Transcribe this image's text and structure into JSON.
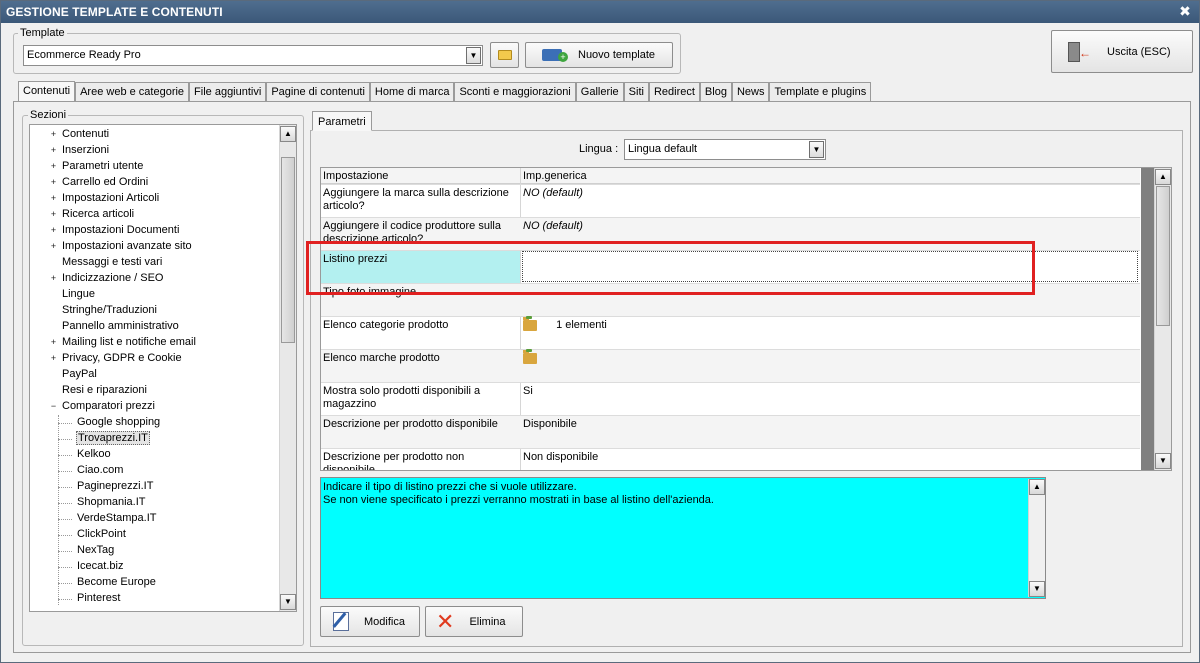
{
  "window": {
    "title": "GESTIONE TEMPLATE E CONTENUTI",
    "close_glyph": "✖"
  },
  "template": {
    "group_label": "Template",
    "selected": "Ecommerce Ready Pro",
    "new_button": "Nuovo template",
    "exit_button": "Uscita (ESC)"
  },
  "tabs": [
    {
      "label": "Contenuti",
      "active": true
    },
    {
      "label": "Aree web e categorie"
    },
    {
      "label": "File aggiuntivi"
    },
    {
      "label": "Pagine di contenuti"
    },
    {
      "label": "Home di marca"
    },
    {
      "label": "Sconti e maggiorazioni"
    },
    {
      "label": "Gallerie"
    },
    {
      "label": "Siti"
    },
    {
      "label": "Redirect"
    },
    {
      "label": "Blog"
    },
    {
      "label": "News"
    },
    {
      "label": "Template e plugins"
    }
  ],
  "sezioni": {
    "label": "Sezioni",
    "items": [
      {
        "label": "Contenuti",
        "expandable": true,
        "level": 1
      },
      {
        "label": "Inserzioni",
        "expandable": true,
        "level": 1
      },
      {
        "label": "Parametri utente",
        "expandable": true,
        "level": 1
      },
      {
        "label": "Carrello ed Ordini",
        "expandable": true,
        "level": 1
      },
      {
        "label": "Impostazioni Articoli",
        "expandable": true,
        "level": 1
      },
      {
        "label": "Ricerca articoli",
        "expandable": true,
        "level": 1
      },
      {
        "label": "Impostazioni Documenti",
        "expandable": true,
        "level": 1
      },
      {
        "label": "Impostazioni avanzate sito",
        "expandable": true,
        "level": 1
      },
      {
        "label": "Messaggi e testi vari",
        "expandable": false,
        "level": 1
      },
      {
        "label": "Indicizzazione / SEO",
        "expandable": true,
        "level": 1
      },
      {
        "label": "Lingue",
        "expandable": false,
        "level": 1
      },
      {
        "label": "Stringhe/Traduzioni",
        "expandable": false,
        "level": 1
      },
      {
        "label": "Pannello amministrativo",
        "expandable": false,
        "level": 1
      },
      {
        "label": "Mailing list e notifiche email",
        "expandable": true,
        "level": 1
      },
      {
        "label": "Privacy, GDPR e Cookie",
        "expandable": true,
        "level": 1
      },
      {
        "label": "PayPal",
        "expandable": false,
        "level": 1
      },
      {
        "label": "Resi e riparazioni",
        "expandable": false,
        "level": 1
      },
      {
        "label": "Comparatori prezzi",
        "expandable": true,
        "expanded": true,
        "level": 1
      },
      {
        "label": "Google shopping",
        "level": 2
      },
      {
        "label": "Trovaprezzi.IT",
        "level": 2,
        "selected": true
      },
      {
        "label": "Kelkoo",
        "level": 2
      },
      {
        "label": "Ciao.com",
        "level": 2
      },
      {
        "label": "Pagineprezzi.IT",
        "level": 2
      },
      {
        "label": "Shopmania.IT",
        "level": 2
      },
      {
        "label": "VerdeStampa.IT",
        "level": 2
      },
      {
        "label": "ClickPoint",
        "level": 2
      },
      {
        "label": "NexTag",
        "level": 2
      },
      {
        "label": "Icecat.biz",
        "level": 2
      },
      {
        "label": "Become Europe",
        "level": 2
      },
      {
        "label": "Pinterest",
        "level": 2
      }
    ]
  },
  "parametri": {
    "tab_label": "Parametri",
    "lingua_label": "Lingua :",
    "lingua_value": "Lingua default",
    "grid": {
      "headers": [
        "Impostazione",
        "Imp.generica"
      ],
      "rows": [
        {
          "setting": "Aggiungere la marca sulla descrizione articolo?",
          "value": "NO (default)",
          "italic": true
        },
        {
          "setting": "Aggiungere il codice produttore sulla descrizione articolo?",
          "value": "NO (default)",
          "italic": true
        },
        {
          "setting": "Listino prezzi",
          "value": "",
          "selected": true
        },
        {
          "setting": "Tipo foto immagine",
          "value": ""
        },
        {
          "setting": "Elenco categorie prodotto",
          "value": "1 elementi",
          "folder": true
        },
        {
          "setting": "Elenco marche prodotto",
          "value": "",
          "folder": true
        },
        {
          "setting": "Mostra solo prodotti disponibili a magazzino",
          "value": "Si"
        },
        {
          "setting": "Descrizione per prodotto disponibile",
          "value": "Disponibile"
        },
        {
          "setting": "Descrizione per prodotto non disponibile",
          "value": "Non disponibile"
        }
      ]
    },
    "description_lines": [
      "Indicare il tipo di listino prezzi che si vuole utilizzare.",
      "Se non viene specificato i prezzi verranno mostrati in base al listino dell'azienda."
    ],
    "modifica_button": "Modifica",
    "elimina_button": "Elimina"
  },
  "colors": {
    "title_bar": "#3f5e80",
    "description_bg": "#00ffff",
    "selected_cell": "#b3f0f0",
    "highlight_border": "#e02020"
  }
}
